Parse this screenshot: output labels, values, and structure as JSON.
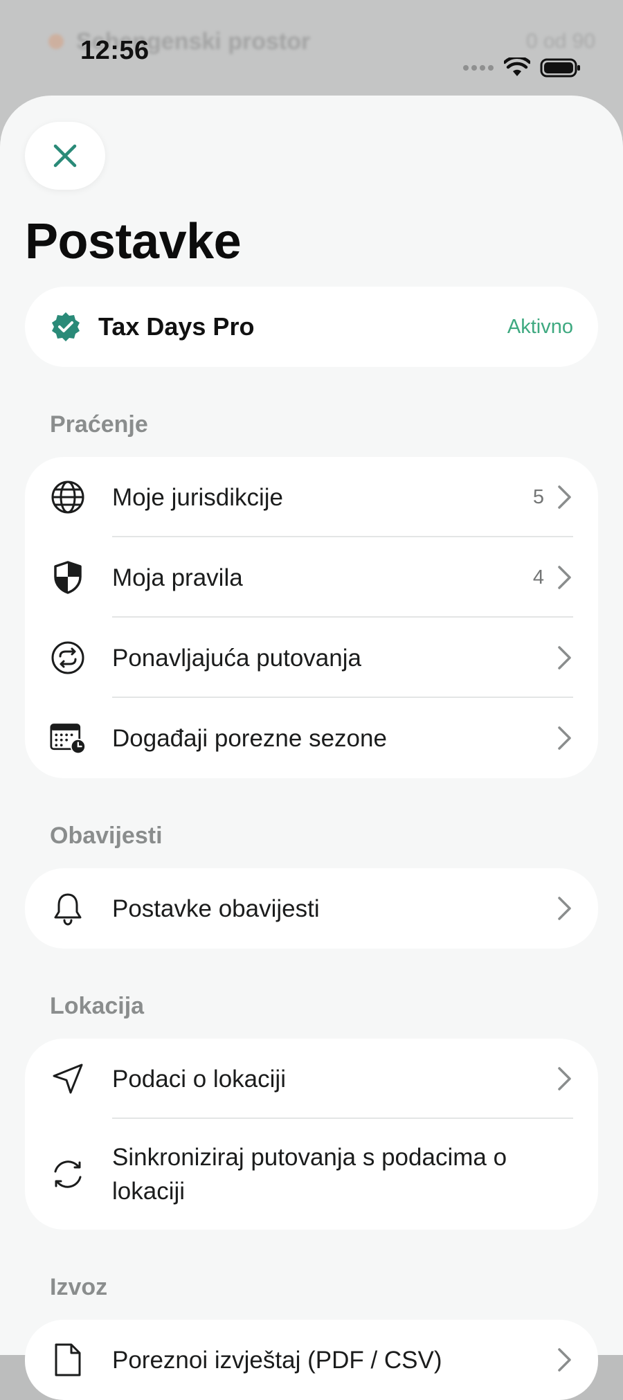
{
  "status_bar": {
    "time": "12:56"
  },
  "background": {
    "ghost_text": "Schengenski prostor",
    "ghost_right": "0 od 90"
  },
  "page": {
    "title": "Postavke"
  },
  "pro": {
    "name": "Tax Days Pro",
    "status": "Aktivno"
  },
  "sections": {
    "tracking": {
      "label": "Praćenje",
      "items": [
        {
          "label": "Moje jurisdikcije",
          "count": "5",
          "icon": "globe-icon"
        },
        {
          "label": "Moja pravila",
          "count": "4",
          "icon": "shield-icon"
        },
        {
          "label": "Ponavljajuća putovanja",
          "count": "",
          "icon": "repeat-icon"
        },
        {
          "label": "Događaji porezne sezone",
          "count": "",
          "icon": "calendar-clock-icon"
        }
      ]
    },
    "notifications": {
      "label": "Obavijesti",
      "items": [
        {
          "label": "Postavke obavijesti",
          "icon": "bell-icon"
        }
      ]
    },
    "location": {
      "label": "Lokacija",
      "items": [
        {
          "label": "Podaci o lokaciji",
          "icon": "location-arrow-icon"
        },
        {
          "label": "Sinkroniziraj putovanja s podacima o lokaciji",
          "icon": "sync-icon"
        }
      ]
    },
    "export": {
      "label": "Izvoz",
      "items": [
        {
          "label": "Poreznoi izvještaj (PDF / CSV)",
          "icon": "document-icon"
        }
      ]
    }
  },
  "colors": {
    "accent": "#2a8a78",
    "active": "#3ea980",
    "sheet": "#f6f7f7"
  }
}
